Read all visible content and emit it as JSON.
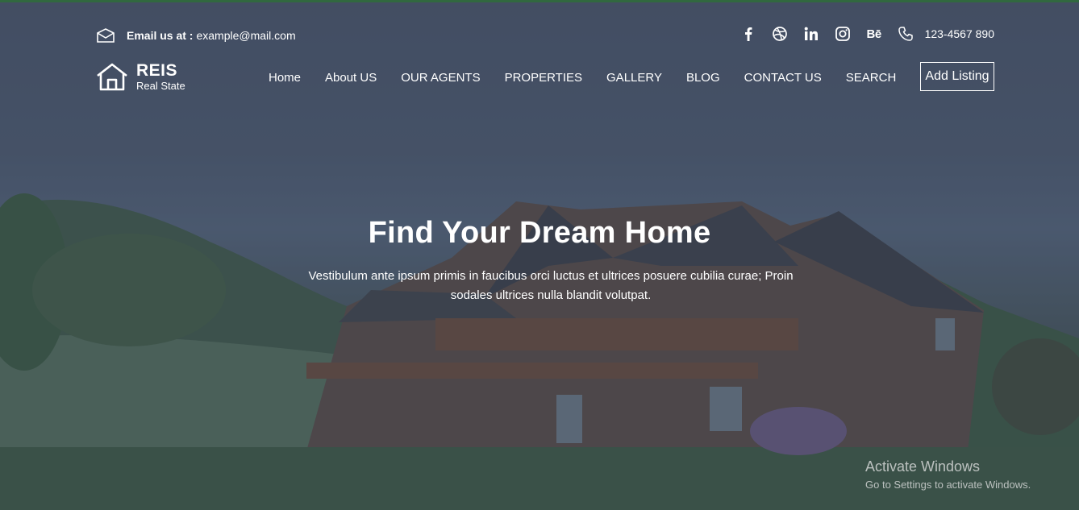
{
  "colors": {
    "top_accent": "#2e7d32",
    "text": "#ffffff"
  },
  "topbar": {
    "email_icon": "envelope-icon",
    "email_label": "Email us at :",
    "email_value": "example@mail.com",
    "social": [
      "facebook-icon",
      "dribbble-icon",
      "linkedin-icon",
      "instagram-icon",
      "behance-icon"
    ],
    "behance_text": "Bē",
    "phone_icon": "phone-icon",
    "phone": "123-4567 890"
  },
  "logo": {
    "icon": "house-icon",
    "name": "REIS",
    "tagline": "Real State"
  },
  "nav": {
    "items": [
      {
        "label": "Home"
      },
      {
        "label": "About US"
      },
      {
        "label": "OUR AGENTS"
      },
      {
        "label": "PROPERTIES"
      },
      {
        "label": "GALLERY"
      },
      {
        "label": "BLOG"
      },
      {
        "label": "CONTACT US"
      },
      {
        "label": "SEARCH"
      }
    ],
    "cta": "Add Listing"
  },
  "hero": {
    "title": "Find Your Dream Home",
    "line1": "Vestibulum ante ipsum primis in faucibus orci luctus et ultrices posuere cubilia curae; Proin",
    "line2": "sodales ultrices nulla blandit volutpat."
  },
  "watermark": {
    "title": "Activate Windows",
    "subtitle": "Go to Settings to activate Windows."
  }
}
